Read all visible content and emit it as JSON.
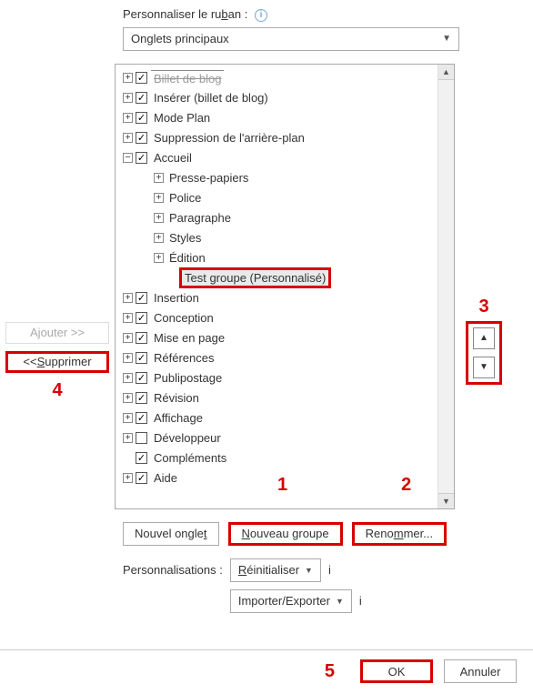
{
  "header": {
    "label_pre": "Personnaliser le ru",
    "label_ukey": "b",
    "label_post": "an :",
    "dropdown_selected": "Onglets principaux"
  },
  "sidebar": {
    "add_pre": "A",
    "add_ukey": "j",
    "add_post": "outer >>",
    "remove_pre": "<< ",
    "remove_ukey": "S",
    "remove_post": "upprimer"
  },
  "tree": {
    "cut_item": "Billet de blog",
    "items": [
      {
        "depth": 0,
        "expander": "+",
        "checked": true,
        "label": "Insérer (billet de blog)"
      },
      {
        "depth": 0,
        "expander": "+",
        "checked": true,
        "label": "Mode Plan"
      },
      {
        "depth": 0,
        "expander": "+",
        "checked": true,
        "label": "Suppression de l'arrière-plan"
      },
      {
        "depth": 0,
        "expander": "−",
        "checked": true,
        "label": "Accueil"
      },
      {
        "depth": 1,
        "expander": "+",
        "checked": null,
        "label": "Presse-papiers"
      },
      {
        "depth": 1,
        "expander": "+",
        "checked": null,
        "label": "Police"
      },
      {
        "depth": 1,
        "expander": "+",
        "checked": null,
        "label": "Paragraphe"
      },
      {
        "depth": 1,
        "expander": "+",
        "checked": null,
        "label": "Styles"
      },
      {
        "depth": 1,
        "expander": "+",
        "checked": null,
        "label": "Édition"
      },
      {
        "depth": 2,
        "expander": "",
        "checked": null,
        "label": "Test groupe (Personnalisé)",
        "selected": true,
        "red": true
      },
      {
        "depth": 0,
        "expander": "+",
        "checked": true,
        "label": "Insertion"
      },
      {
        "depth": 0,
        "expander": "+",
        "checked": true,
        "label": "Conception"
      },
      {
        "depth": 0,
        "expander": "+",
        "checked": true,
        "label": "Mise en page"
      },
      {
        "depth": 0,
        "expander": "+",
        "checked": true,
        "label": "Références"
      },
      {
        "depth": 0,
        "expander": "+",
        "checked": true,
        "label": "Publipostage"
      },
      {
        "depth": 0,
        "expander": "+",
        "checked": true,
        "label": "Révision"
      },
      {
        "depth": 0,
        "expander": "+",
        "checked": true,
        "label": "Affichage"
      },
      {
        "depth": 0,
        "expander": "+",
        "checked": false,
        "label": "Développeur"
      },
      {
        "depth": 0,
        "expander": "",
        "checked": true,
        "label": "Compléments"
      },
      {
        "depth": 0,
        "expander": "+",
        "checked": true,
        "label": "Aide"
      }
    ]
  },
  "buttons": {
    "new_tab_pre": "Nouvel ongle",
    "new_tab_ukey": "t",
    "new_group_ukey": "N",
    "new_group_post": "ouveau groupe",
    "rename_pre": "Reno",
    "rename_ukey": "m",
    "rename_post": "mer..."
  },
  "perso": {
    "label": "Personnalisations :",
    "reset_ukey": "R",
    "reset_post": "éinitialiser",
    "import_export": "Importer/Exporter"
  },
  "footer": {
    "ok": "OK",
    "cancel": "Annuler"
  },
  "annotations": {
    "n1": "1",
    "n2": "2",
    "n3": "3",
    "n4": "4",
    "n5": "5"
  }
}
